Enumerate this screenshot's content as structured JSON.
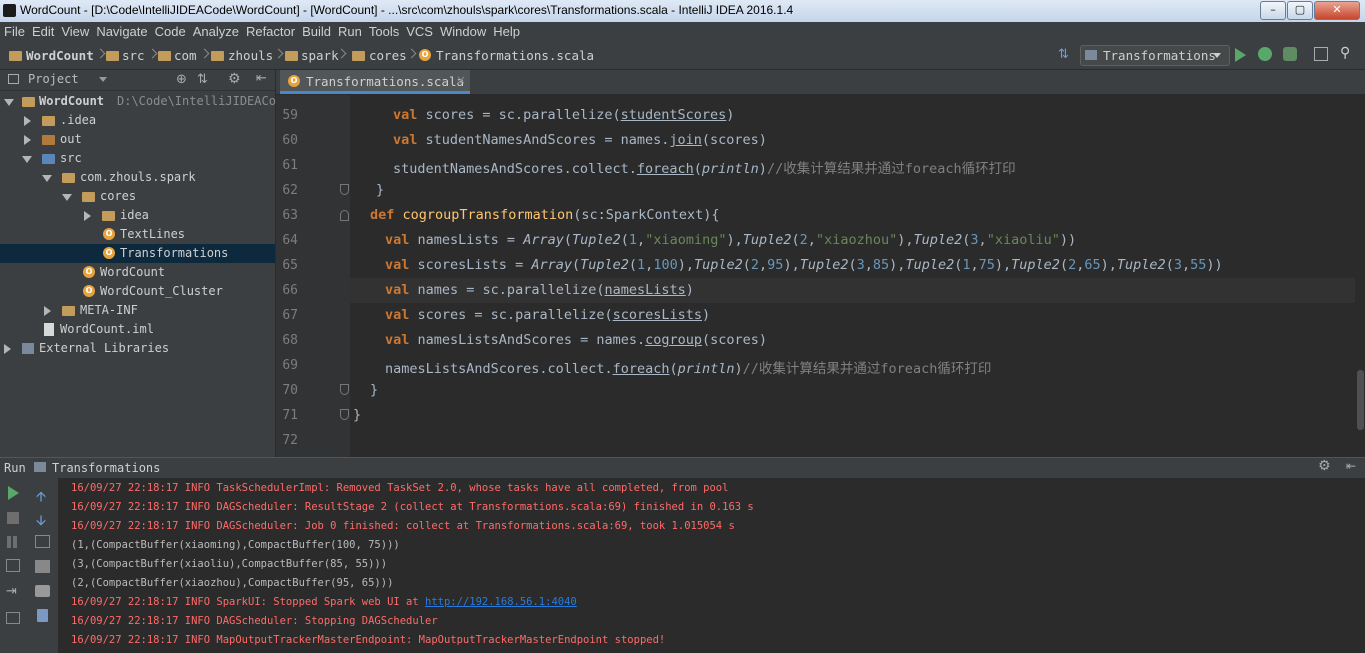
{
  "window": {
    "title": "WordCount - [D:\\Code\\IntelliJIDEACode\\WordCount] - [WordCount] - ...\\src\\com\\zhouls\\spark\\cores\\Transformations.scala - IntelliJ IDEA 2016.1.4"
  },
  "menu": [
    "File",
    "Edit",
    "View",
    "Navigate",
    "Code",
    "Analyze",
    "Refactor",
    "Build",
    "Run",
    "Tools",
    "VCS",
    "Window",
    "Help"
  ],
  "breadcrumbs": [
    "WordCount",
    "src",
    "com",
    "zhouls",
    "spark",
    "cores",
    "Transformations.scala"
  ],
  "run_config": "Transformations",
  "project_panel": {
    "title": "Project"
  },
  "tree": [
    {
      "label": "WordCount",
      "path": "D:\\Code\\IntelliJIDEACod"
    },
    {
      "label": ".idea"
    },
    {
      "label": "out"
    },
    {
      "label": "src"
    },
    {
      "label": "com.zhouls.spark"
    },
    {
      "label": "cores"
    },
    {
      "label": "idea"
    },
    {
      "label": "TextLines"
    },
    {
      "label": "Transformations"
    },
    {
      "label": "WordCount"
    },
    {
      "label": "WordCount_Cluster"
    },
    {
      "label": "META-INF"
    },
    {
      "label": "WordCount.iml"
    },
    {
      "label": "External Libraries"
    }
  ],
  "editor_tab": "Transformations.scala",
  "line_numbers": [
    "59",
    "60",
    "61",
    "62",
    "63",
    "64",
    "65",
    "66",
    "67",
    "68",
    "69",
    "70",
    "71",
    "72"
  ],
  "code": {
    "l59": [
      "val",
      "scores = sc.parallelize(",
      "studentScores",
      ")"
    ],
    "l60": [
      "val",
      "studentNamesAndScores = names.",
      "join",
      "(scores)"
    ],
    "l61": [
      "studentNamesAndScores.collect.",
      "foreach",
      "(",
      "println",
      ")",
      "//收集计算结果并通过foreach循环打印"
    ],
    "l62": [
      "}"
    ],
    "l63": [
      "def",
      "cogroupTransformation",
      "(sc:SparkContext){"
    ],
    "l64": [
      "val",
      "namesLists = ",
      "Array",
      "(",
      "Tuple2",
      "(",
      "1",
      ",",
      "\"xiaoming\"",
      "),",
      "Tuple2",
      "(",
      "2",
      ",",
      "\"xiaozhou\"",
      "),",
      "Tuple2",
      "(",
      "3",
      ",",
      "\"xiaoliu\"",
      "))"
    ],
    "l65": [
      "val",
      "scoresLists = ",
      "Array",
      "(",
      "Tuple2",
      "(",
      "1",
      ",",
      "100",
      "),",
      "Tuple2",
      "(",
      "2",
      ",",
      "95",
      "),",
      "Tuple2",
      "(",
      "3",
      ",",
      "85",
      "),",
      "Tuple2",
      "(",
      "1",
      ",",
      "75",
      "),",
      "Tuple2",
      "(",
      "2",
      ",",
      "65",
      "),",
      "Tuple2",
      "(",
      "3",
      ",",
      "55",
      "))"
    ],
    "l66": [
      "val",
      "names = sc.parallelize(",
      "namesLists",
      ")"
    ],
    "l67": [
      "val",
      "scores = sc.parallelize(",
      "scoresLists",
      ")"
    ],
    "l68": [
      "val",
      "namesListsAndScores = names.",
      "cogroup",
      "(scores)"
    ],
    "l69": [
      "namesListsAndScores.collect.",
      "foreach",
      "(",
      "println",
      ")",
      "//收集计算结果并通过foreach循环打印"
    ],
    "l70": [
      "}"
    ],
    "l71": [
      "}"
    ]
  },
  "run_panel": {
    "label": "Run",
    "config": "Transformations"
  },
  "console": [
    {
      "type": "err",
      "text": "16/09/27 22:18:17 INFO TaskSchedulerImpl: Removed TaskSet 2.0, whose tasks have all completed, from pool"
    },
    {
      "type": "err",
      "text": "16/09/27 22:18:17 INFO DAGScheduler: ResultStage 2 (collect at Transformations.scala:69) finished in 0.163 s"
    },
    {
      "type": "err",
      "text": "16/09/27 22:18:17 INFO DAGScheduler: Job 0 finished: collect at Transformations.scala:69, took 1.015054 s"
    },
    {
      "type": "out",
      "text": "(1,(CompactBuffer(xiaoming),CompactBuffer(100, 75)))"
    },
    {
      "type": "out",
      "text": "(3,(CompactBuffer(xiaoliu),CompactBuffer(85, 55)))"
    },
    {
      "type": "out",
      "text": "(2,(CompactBuffer(xiaozhou),CompactBuffer(95, 65)))"
    },
    {
      "type": "err",
      "text": "16/09/27 22:18:17 INFO SparkUI: Stopped Spark web UI at ",
      "link": "http://192.168.56.1:4040"
    },
    {
      "type": "err",
      "text": "16/09/27 22:18:17 INFO DAGScheduler: Stopping DAGScheduler"
    },
    {
      "type": "err",
      "text": "16/09/27 22:18:17 INFO MapOutputTrackerMasterEndpoint: MapOutputTrackerMasterEndpoint stopped!"
    }
  ]
}
